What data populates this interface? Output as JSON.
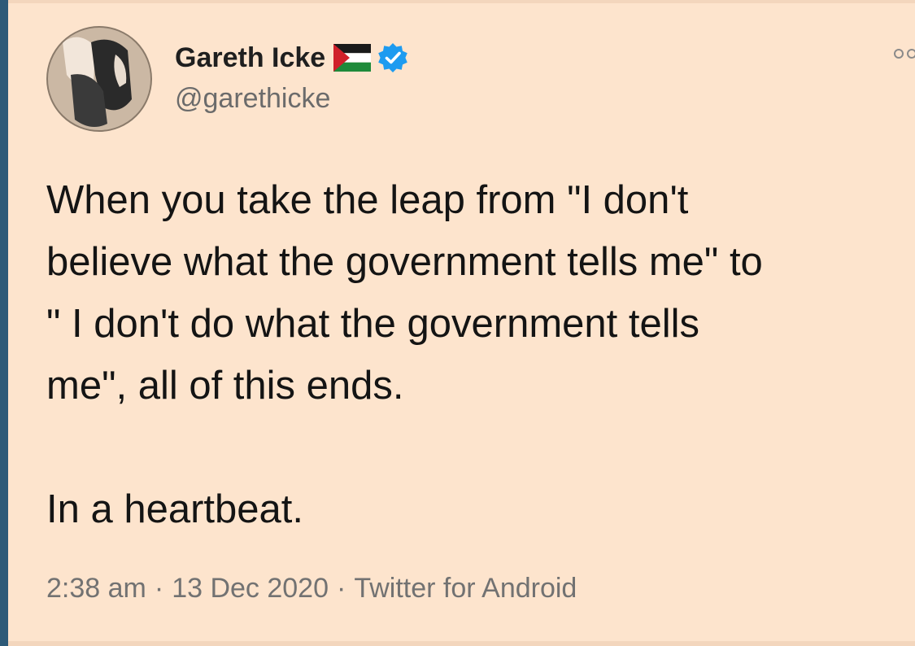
{
  "account": {
    "display_name": "Gareth Icke",
    "handle": "@garethicke",
    "name_icons": [
      "palestine-flag-icon",
      "verified-badge-icon"
    ],
    "verified_color": "#1d9bf0"
  },
  "tweet": {
    "lines": [
      "When you take the leap from \"I don't",
      "believe what the government tells me\" to",
      "\" I don't do what the government tells",
      "me\", all of this ends."
    ],
    "closing_line": "In a heartbeat."
  },
  "meta": {
    "time": "2:38 am",
    "date": "13 Dec 2020",
    "source": "Twitter for Android"
  },
  "colors": {
    "background": "#fde4cd",
    "text": "#141414",
    "secondary_text": "#727272"
  }
}
